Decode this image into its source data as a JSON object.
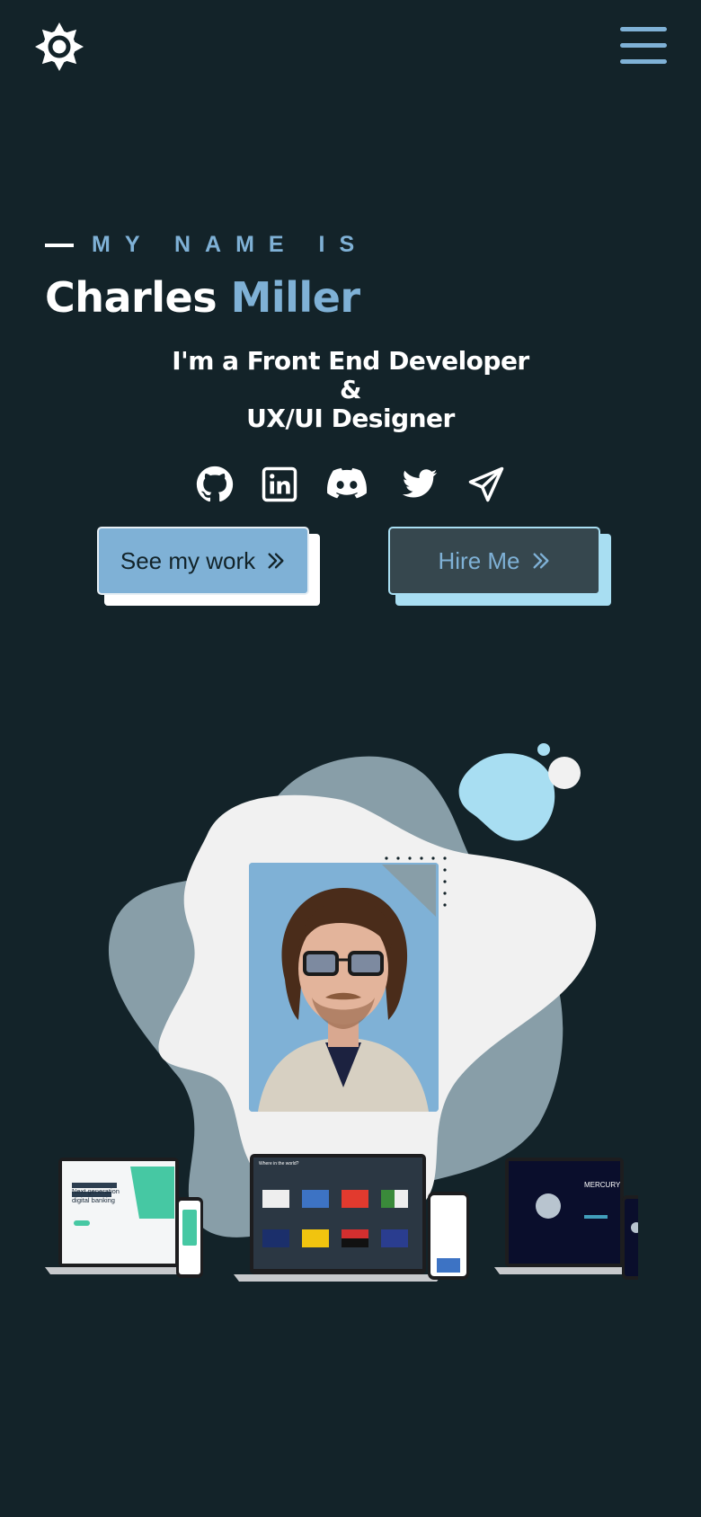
{
  "header": {
    "theme_toggle_icon": "sun-gear-icon",
    "menu_icon": "hamburger-menu-icon"
  },
  "intro": {
    "eyebrow": "MY NAME IS",
    "first_name": "Charles",
    "last_name": "Miller",
    "roles": [
      "I'm a Front End Developer",
      "&",
      "UX/UI Designer"
    ]
  },
  "socials": [
    {
      "icon": "github-icon"
    },
    {
      "icon": "linkedin-icon"
    },
    {
      "icon": "discord-icon"
    },
    {
      "icon": "twitter-icon"
    },
    {
      "icon": "telegram-icon"
    }
  ],
  "buttons": {
    "work_label": "See my work",
    "hire_label": "Hire Me",
    "arrow_icon": "double-chevron-right-icon"
  },
  "colors": {
    "background": "#132329",
    "accent": "#7fb1d6",
    "accent_light": "#a8def2",
    "blob_light": "#f1f1f1",
    "blob_muted": "#889ea8"
  },
  "hero": {
    "portrait": "profile-photo",
    "devices": [
      {
        "caption_lines": [
          "Next generation",
          "digital banking"
        ]
      },
      {
        "caption_lines": [
          "Where in the world?"
        ]
      },
      {
        "caption_lines": [
          "MERCURY"
        ]
      }
    ]
  }
}
